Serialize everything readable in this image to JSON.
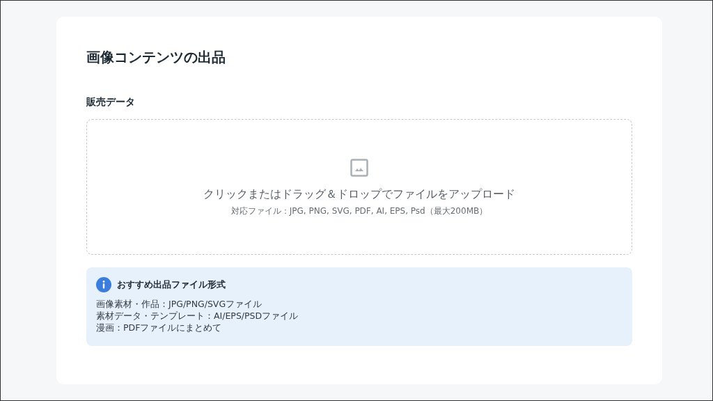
{
  "page": {
    "title": "画像コンテンツの出品"
  },
  "section": {
    "label": "販売データ"
  },
  "dropzone": {
    "instruction": "クリックまたはドラッグ＆ドロップでファイルをアップロード",
    "formats": "対応ファイル：JPG, PNG, SVG, PDF, AI, EPS, Psd（最大200MB）"
  },
  "recommendation": {
    "title": "おすすめ出品ファイル形式",
    "lines": [
      "画像素材・作品：JPG/PNG/SVGファイル",
      "素材データ・テンプレート：AI/EPS/PSDファイル",
      "漫画：PDFファイルにまとめて"
    ]
  }
}
